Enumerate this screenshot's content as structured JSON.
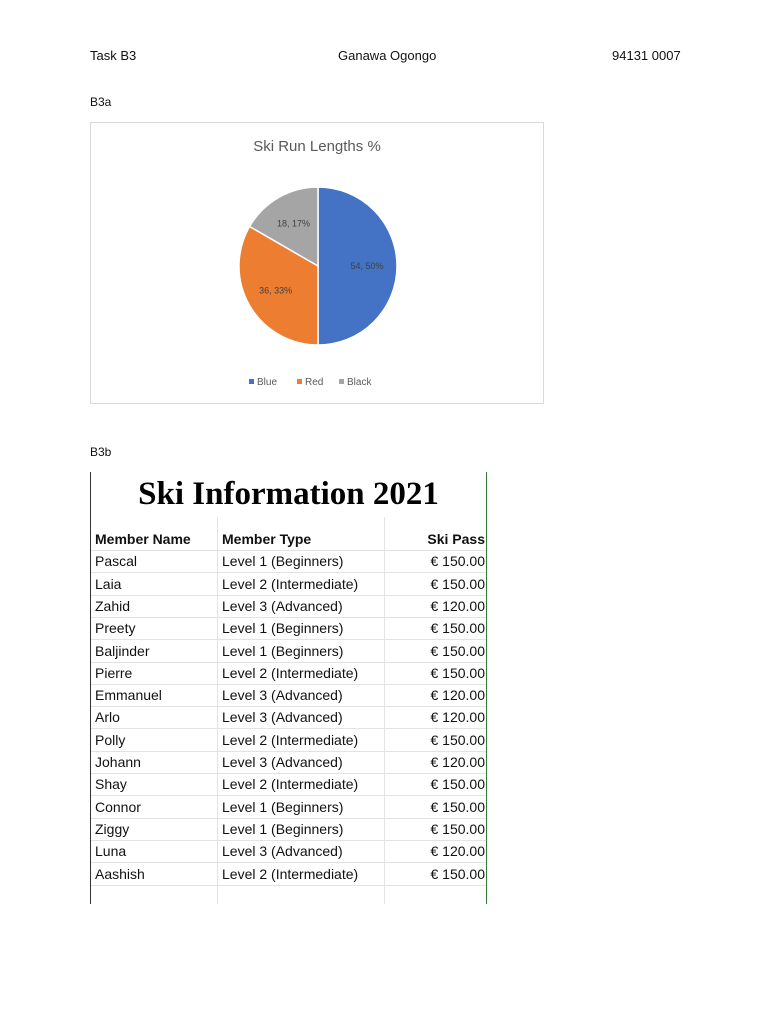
{
  "header": {
    "task": "Task B3",
    "author": "Ganawa Ogongo",
    "id_number": "94131 0007"
  },
  "sections": {
    "a_label": "B3a",
    "b_label": "B3b"
  },
  "chart_data": {
    "type": "pie",
    "title": "Ski Run Lengths %",
    "categories": [
      "Blue",
      "Red",
      "Black"
    ],
    "values": [
      54,
      36,
      18
    ],
    "labels": [
      "54, 50%",
      "36, 33%",
      "18, 17%"
    ],
    "colors": [
      "#4472c4",
      "#ed7d31",
      "#a5a5a5"
    ],
    "legend_position": "bottom"
  },
  "sheet": {
    "title": "Ski Information 2021",
    "columns": [
      "Member Name",
      "Member Type",
      "Ski Pass"
    ],
    "rows": [
      [
        "Pascal",
        "Level 1 (Beginners)",
        "€ 150.00"
      ],
      [
        "Laia",
        "Level 2 (Intermediate)",
        "€ 150.00"
      ],
      [
        "Zahid",
        "Level 3 (Advanced)",
        "€ 120.00"
      ],
      [
        "Preety",
        "Level 1 (Beginners)",
        "€ 150.00"
      ],
      [
        "Baljinder",
        "Level 1 (Beginners)",
        "€ 150.00"
      ],
      [
        "Pierre",
        "Level 2 (Intermediate)",
        "€ 150.00"
      ],
      [
        "Emmanuel",
        "Level 3 (Advanced)",
        "€ 120.00"
      ],
      [
        "Arlo",
        "Level 3 (Advanced)",
        "€ 120.00"
      ],
      [
        "Polly",
        "Level 2 (Intermediate)",
        "€ 150.00"
      ],
      [
        "Johann",
        "Level 3 (Advanced)",
        "€ 120.00"
      ],
      [
        "Shay",
        "Level 2 (Intermediate)",
        "€ 150.00"
      ],
      [
        "Connor",
        "Level 1 (Beginners)",
        "€ 150.00"
      ],
      [
        "Ziggy",
        "Level 1 (Beginners)",
        "€ 150.00"
      ],
      [
        "Luna",
        "Level 3 (Advanced)",
        "€ 120.00"
      ],
      [
        "Aashish",
        "Level 2 (Intermediate)",
        "€ 150.00"
      ]
    ]
  }
}
